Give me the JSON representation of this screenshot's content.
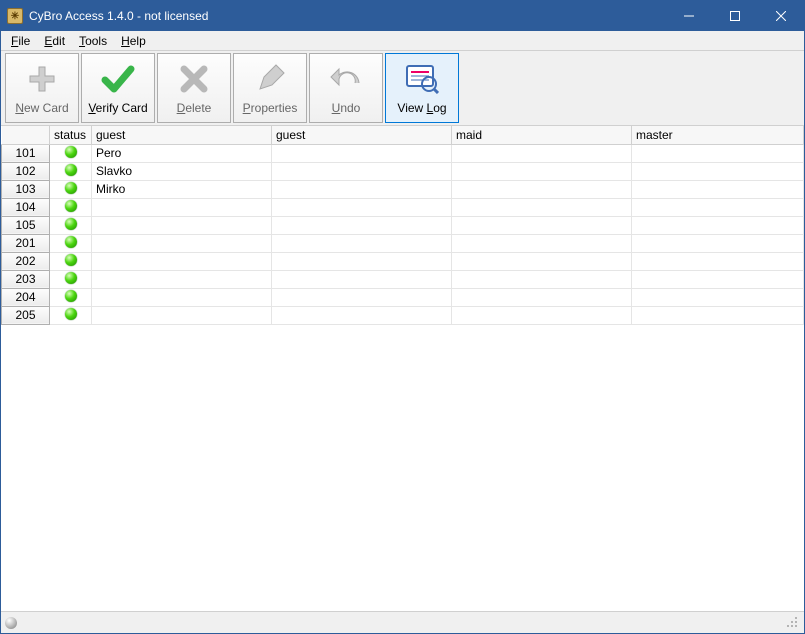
{
  "window": {
    "title": "CyBro Access 1.4.0 - not licensed"
  },
  "menu": {
    "file": "File",
    "edit": "Edit",
    "tools": "Tools",
    "help": "Help"
  },
  "toolbar": {
    "new_card": "New Card",
    "verify_card": "Verify Card",
    "delete": "Delete",
    "properties": "Properties",
    "undo": "Undo",
    "view_log": "View Log"
  },
  "columns": {
    "rowhdr": "",
    "status": "status",
    "guest1": "guest",
    "guest2": "guest",
    "maid": "maid",
    "master": "master"
  },
  "rows": [
    {
      "id": "101",
      "status": "green",
      "guest": "Pero",
      "guest2": "",
      "maid": "",
      "master": ""
    },
    {
      "id": "102",
      "status": "green",
      "guest": "Slavko",
      "guest2": "",
      "maid": "",
      "master": ""
    },
    {
      "id": "103",
      "status": "green",
      "guest": "Mirko",
      "guest2": "",
      "maid": "",
      "master": ""
    },
    {
      "id": "104",
      "status": "green",
      "guest": "",
      "guest2": "",
      "maid": "",
      "master": ""
    },
    {
      "id": "105",
      "status": "green",
      "guest": "",
      "guest2": "",
      "maid": "",
      "master": ""
    },
    {
      "id": "201",
      "status": "green",
      "guest": "",
      "guest2": "",
      "maid": "",
      "master": ""
    },
    {
      "id": "202",
      "status": "green",
      "guest": "",
      "guest2": "",
      "maid": "",
      "master": ""
    },
    {
      "id": "203",
      "status": "green",
      "guest": "",
      "guest2": "",
      "maid": "",
      "master": ""
    },
    {
      "id": "204",
      "status": "green",
      "guest": "",
      "guest2": "",
      "maid": "",
      "master": ""
    },
    {
      "id": "205",
      "status": "green",
      "guest": "",
      "guest2": "",
      "maid": "",
      "master": ""
    }
  ]
}
